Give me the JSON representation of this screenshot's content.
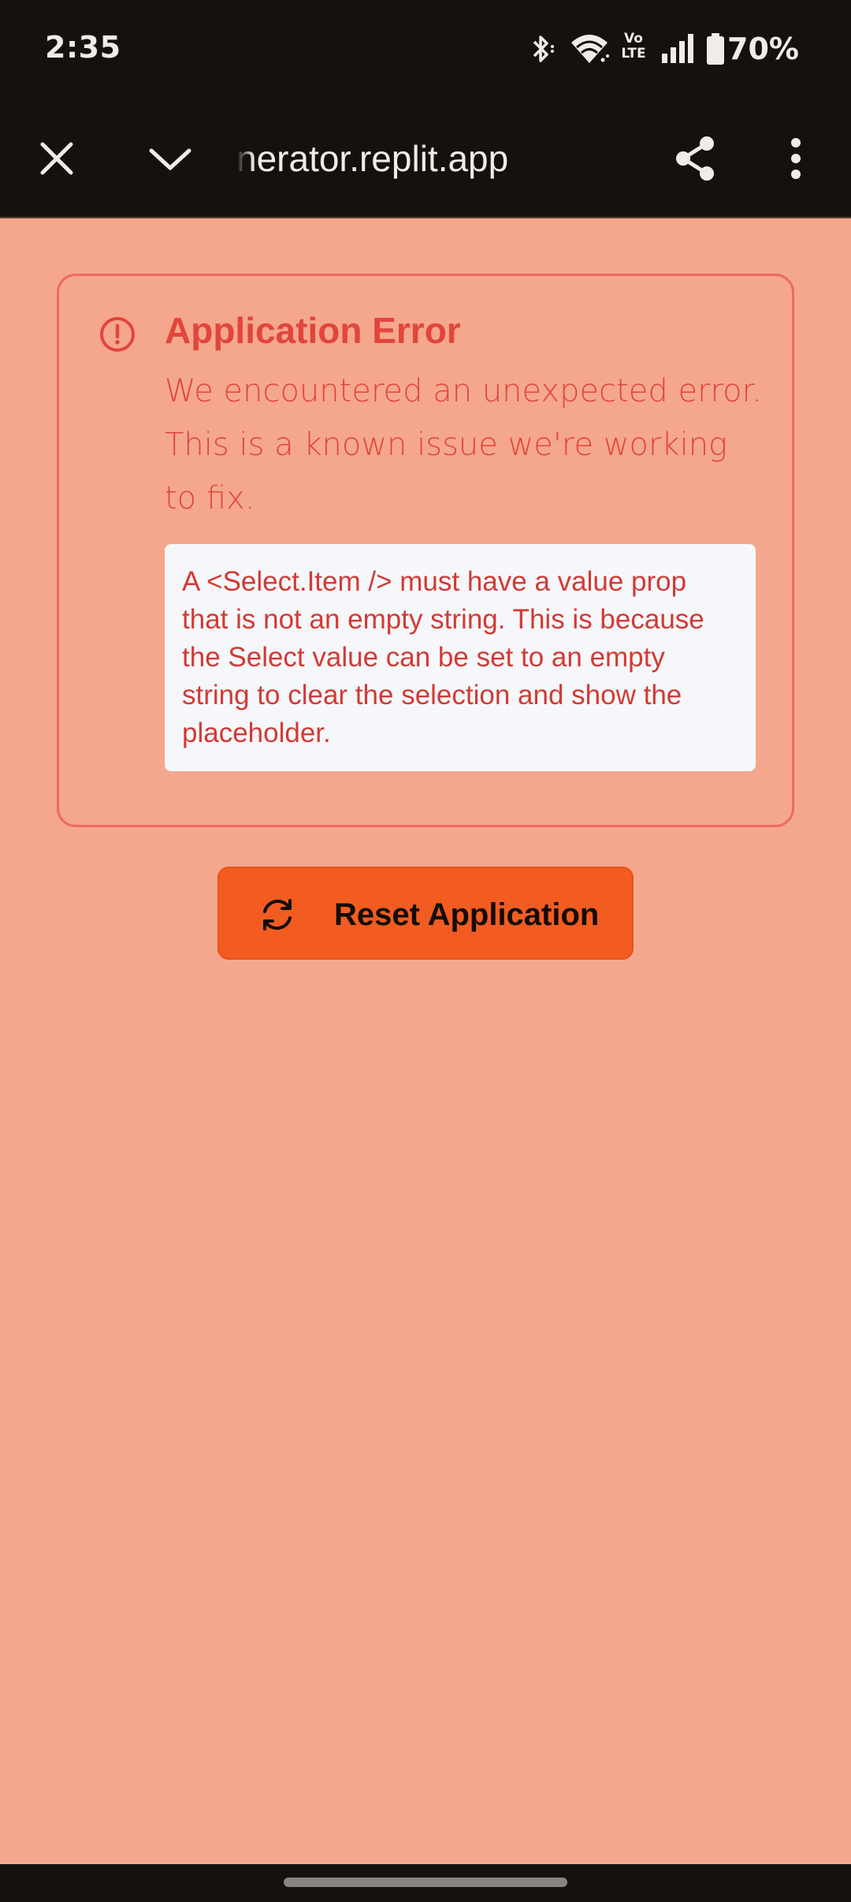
{
  "status_bar": {
    "time": "2:35",
    "battery": "70%",
    "icons": [
      "bluetooth-icon",
      "wifi-icon",
      "volte-icon",
      "signal-icon",
      "battery-icon"
    ],
    "volte_text": [
      "Vo",
      "LTE"
    ]
  },
  "toolbar": {
    "url": "nerator.replit.app",
    "icons": [
      "close-icon",
      "chevron-down-icon",
      "share-icon",
      "more-vert-icon"
    ]
  },
  "error": {
    "title": "Application Error",
    "description": "We encountered an unexpected error. This is a known issue we're working to fix.",
    "detail": "A <Select.Item /> must have a value prop that is not an empty string. This is because the Select value can be set to an empty string to clear the selection and show the placeholder."
  },
  "actions": {
    "reset_label": "Reset Application"
  },
  "colors": {
    "background": "#f5a78d",
    "error_text": "#e2453b",
    "card_border": "#ef6a5d",
    "detail_bg": "#f6f7fa",
    "button_bg": "#f25c21",
    "bars": "#16110f"
  }
}
